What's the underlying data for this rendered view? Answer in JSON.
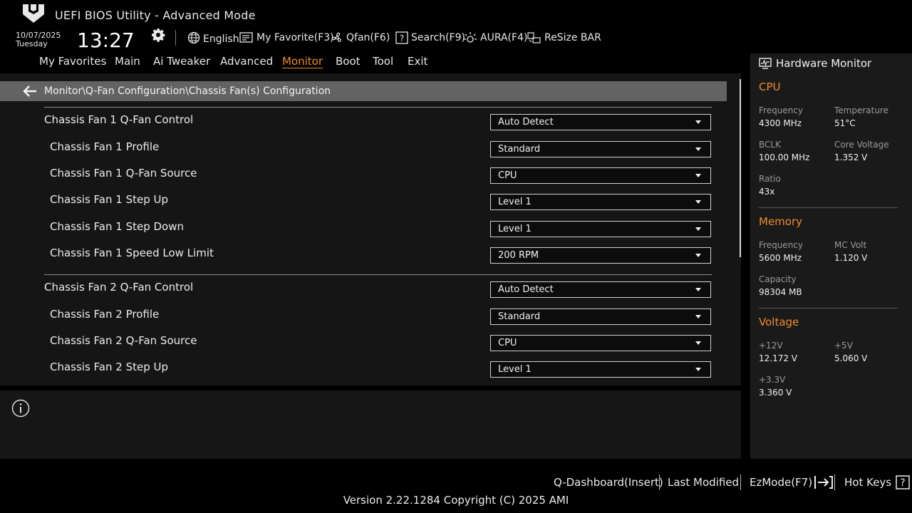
{
  "header": {
    "app_title": "UEFI BIOS Utility - Advanced Mode",
    "date": "10/07/2025",
    "day": "Tuesday",
    "time": "13:27",
    "language": "English",
    "my_favorite": "My Favorite(F3)",
    "qfan": "Qfan(F6)",
    "search": "Search(F9)",
    "aura": "AURA(F4)",
    "resize_bar": "ReSize BAR"
  },
  "tabs": [
    "My Favorites",
    "Main",
    "Ai Tweaker",
    "Advanced",
    "Monitor",
    "Boot",
    "Tool",
    "Exit"
  ],
  "active_tab": "Monitor",
  "breadcrumb": "Monitor\\Q-Fan Configuration\\Chassis Fan(s) Configuration",
  "settings": [
    {
      "label": "Chassis Fan 1 Q-Fan Control",
      "value": "Auto Detect"
    },
    {
      "label": "Chassis Fan 1 Profile",
      "value": "Standard"
    },
    {
      "label": "Chassis Fan 1 Q-Fan Source",
      "value": "CPU"
    },
    {
      "label": "Chassis Fan 1 Step Up",
      "value": "Level 1"
    },
    {
      "label": "Chassis Fan 1 Step Down",
      "value": "Level 1"
    },
    {
      "label": "Chassis Fan 1 Speed Low Limit",
      "value": "200 RPM"
    },
    {
      "label": "Chassis Fan 2 Q-Fan Control",
      "value": "Auto Detect"
    },
    {
      "label": "Chassis Fan 2 Profile",
      "value": "Standard"
    },
    {
      "label": "Chassis Fan 2 Q-Fan Source",
      "value": "CPU"
    },
    {
      "label": "Chassis Fan 2 Step Up",
      "value": "Level 1"
    }
  ],
  "hw_monitor": {
    "title": "Hardware Monitor",
    "cpu": {
      "title": "CPU",
      "frequency_label": "Frequency",
      "frequency": "4300 MHz",
      "temperature_label": "Temperature",
      "temperature": "51°C",
      "bclk_label": "BCLK",
      "bclk": "100.00 MHz",
      "core_voltage_label": "Core Voltage",
      "core_voltage": "1.352 V",
      "ratio_label": "Ratio",
      "ratio": "43x"
    },
    "memory": {
      "title": "Memory",
      "frequency_label": "Frequency",
      "frequency": "5600 MHz",
      "mc_volt_label": "MC Volt",
      "mc_volt": "1.120 V",
      "capacity_label": "Capacity",
      "capacity": "98304 MB"
    },
    "voltage": {
      "title": "Voltage",
      "v12_label": "+12V",
      "v12": "12.172 V",
      "v5_label": "+5V",
      "v5": "5.060 V",
      "v33_label": "+3.3V",
      "v33": "3.360 V"
    }
  },
  "footer": {
    "q_dashboard": "Q-Dashboard(Insert)",
    "last_modified": "Last Modified",
    "ezmode": "EzMode(F7)",
    "hot_keys": "Hot Keys",
    "version": "Version 2.22.1284 Copyright (C) 2025 AMI"
  },
  "colors": {
    "accent": "#f08c2a",
    "breadcrumb_bg": "#636363",
    "panel_bg": "#151515"
  }
}
